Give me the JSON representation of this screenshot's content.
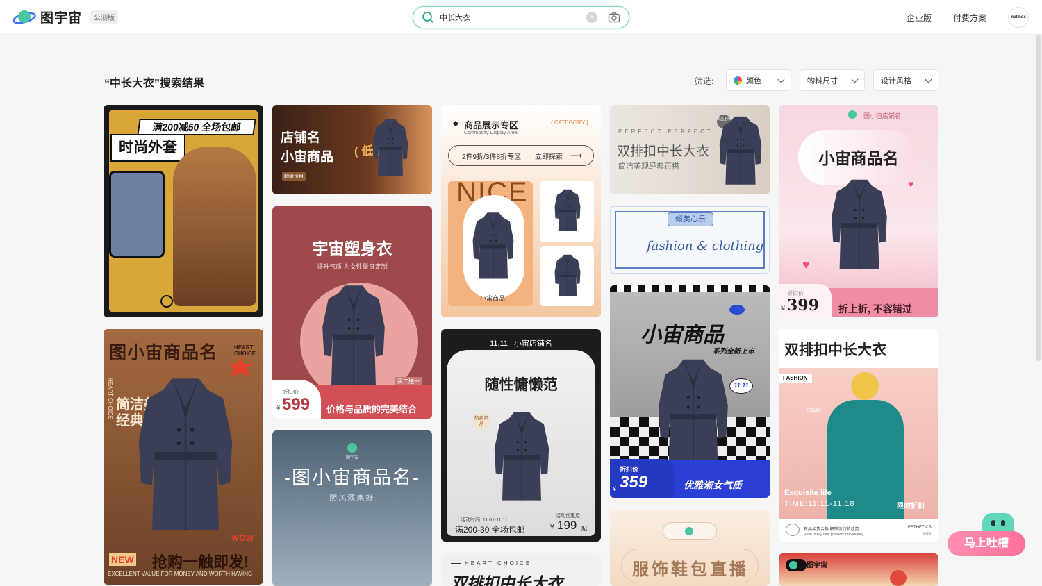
{
  "header": {
    "app_name": "图宇宙",
    "beta_badge": "公测版",
    "search_value": "中长大衣",
    "nav": [
      "企业版",
      "付费方案"
    ],
    "avatar_text": "nollbox"
  },
  "results": {
    "title": "“中长大衣”搜索结果",
    "filter_label": "筛选:",
    "filters": [
      "颜色",
      "物料尺寸",
      "设计风格"
    ]
  },
  "cards": {
    "c1": {
      "banner": "满200减50 全场包邮",
      "title": "时尚外套"
    },
    "c2": {
      "line1": "店铺名",
      "line2": "小宙商品",
      "promo": "( 低至5折!",
      "tag": "超级价目"
    },
    "c3": {
      "title": "宇宙塑身衣",
      "subtitle": "提升气质 为女性量身定制",
      "price_label": "折扣价",
      "currency": "¥",
      "price": "599",
      "slogan": "价格与品质的完美结合",
      "tag": "买二送一"
    },
    "c4": {
      "title": "-图小宙商品名-",
      "subtitle": "防风效果好",
      "logo": "图宇宙"
    },
    "c5": {
      "banner": "图小宙商品名",
      "badge": "HEART CHOICE",
      "line1": "简洁美观",
      "line2": "经典百搭",
      "new": "NEW",
      "slogan": "抢购一触即发!",
      "wow": "WOW",
      "footer": "EXCELLENT VALUE FOR MONEY AND WORTH HAVING",
      "side": "HEART CHOICE"
    },
    "c6": {
      "title": "商品展示专区",
      "subtitle": "Commodity Display Area",
      "category": "{ CATEGORY }",
      "pill": "2件9折/3件8折专区",
      "explore": "立即探索",
      "nice": "NICE",
      "product": "小宙商品"
    },
    "c7": {
      "top": "11.11 | 小宙店铺名",
      "title": "随性慵懒范",
      "badge": "热卖商品",
      "time": "活动时间: 11.01-11.11",
      "deal": "满200-30 全场包邮",
      "after": "活动优惠后",
      "currency": "¥",
      "price": "199",
      "unit": "起"
    },
    "c8": {
      "title": "双排扣中长大衣",
      "eyebrow": "PERFECT PERFECT",
      "subtitle": "简洁美观经典百搭",
      "tag": "新品上市"
    },
    "c9": {
      "banner": "倾美心乐",
      "script": "fashion & clothing"
    },
    "c10": {
      "title": "小宙商品",
      "subtitle": "系列全新上市",
      "bubble": "11.11",
      "label": "折扣价",
      "currency": "¥",
      "price": "359",
      "slogan": "优雅淑女气质"
    },
    "c11": {
      "title": "服饰鞋包直播"
    },
    "c12": {
      "shop": "图小宙店铺名",
      "title": "小宙商品名",
      "label": "折扣价",
      "currency": "¥",
      "price": "399",
      "slogan": "折上折, 不容错过"
    },
    "c13": {
      "title": "双排扣中长大衣",
      "tag": "FASHION",
      "return": "return",
      "life": "Exquisite life",
      "time": "TIME:11.11-11.18",
      "limit": "限时折扣",
      "cn_note": "新品尖货合集 解锁流行新趋势",
      "en_note": "Rush to buy new products immediately",
      "brand": "ESTHETICS",
      "year": "2022"
    },
    "c14": {
      "eyebrow": "HEART CHOICE",
      "title": "双排扣中长大衣"
    },
    "c15": {
      "logo": "图宇宙"
    }
  },
  "feedback": "马上吐槽"
}
